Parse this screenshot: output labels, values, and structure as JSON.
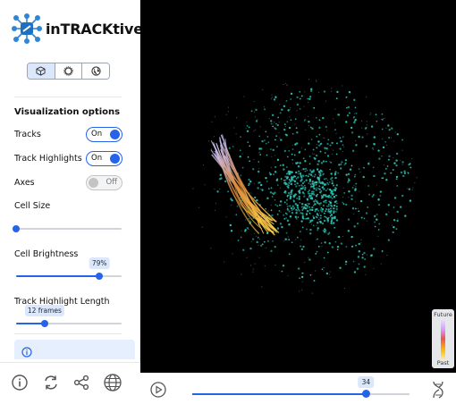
{
  "app": {
    "name": "inTRACKtive",
    "brand_color": "#2563eb"
  },
  "view_tabs": [
    {
      "icon": "cube-icon",
      "active": true
    },
    {
      "icon": "circle-outline-icon",
      "active": false
    },
    {
      "icon": "globe-icon",
      "active": false
    }
  ],
  "visualization": {
    "title": "Visualization options",
    "tracks": {
      "label": "Tracks",
      "state": "On"
    },
    "track_highlights": {
      "label": "Track Highlights",
      "state": "On"
    },
    "axes": {
      "label": "Axes",
      "state": "Off"
    },
    "cell_size": {
      "label": "Cell Size",
      "value_fraction": 0.0
    },
    "cell_brightness": {
      "label": "Cell Brightness",
      "value": "79%",
      "value_fraction": 0.79
    },
    "track_highlight_length": {
      "label": "Track Highlight Length",
      "value": "12 frames",
      "value_fraction": 0.27
    }
  },
  "bottom_icons": [
    "info-icon",
    "refresh-icon",
    "share-icon",
    "globe-icon"
  ],
  "legend": {
    "future": "Future",
    "past": "Past"
  },
  "timeline": {
    "frame": "34",
    "value_fraction": 0.8
  },
  "colors": {
    "cells": "#2ec4b6",
    "tracks": "#ffb020",
    "background": "#000000"
  }
}
